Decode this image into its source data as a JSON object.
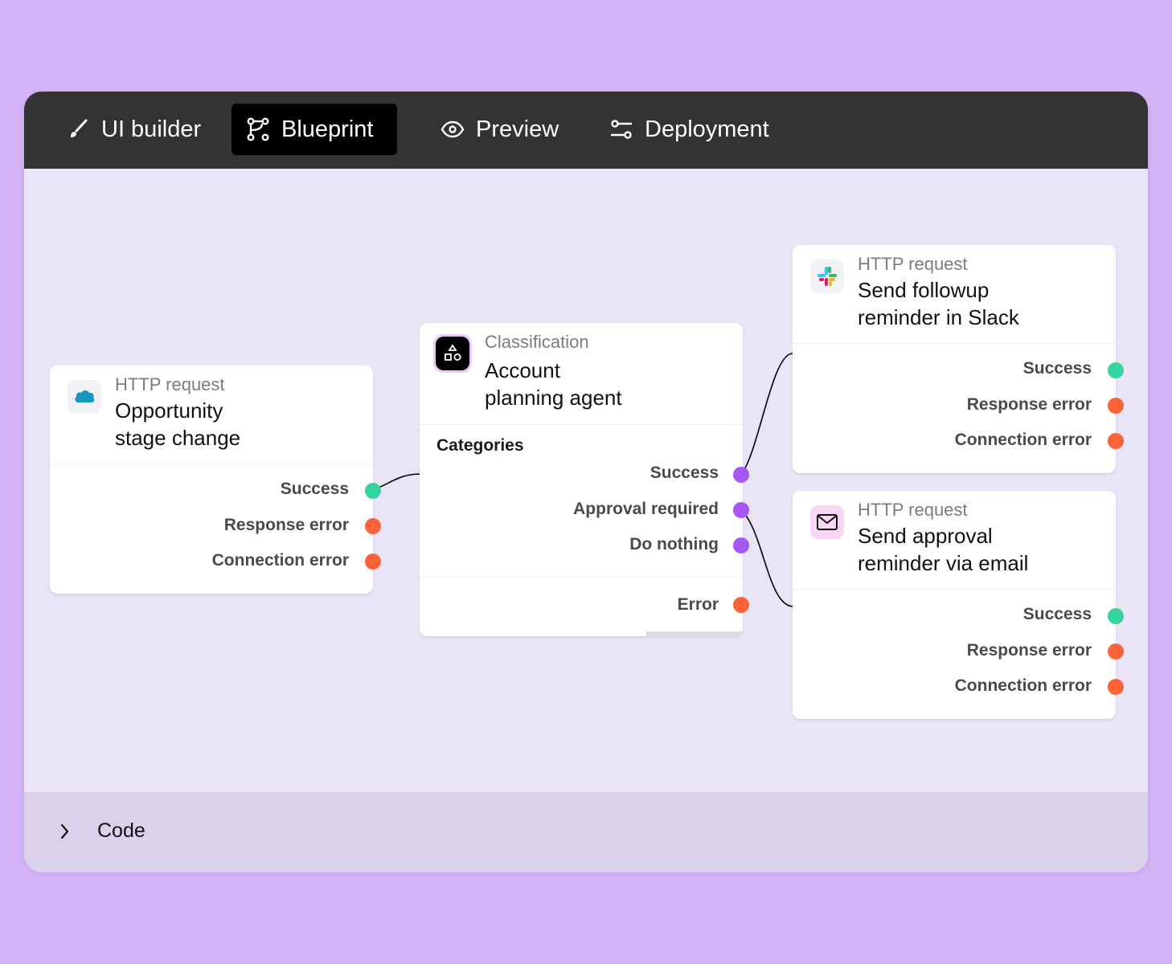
{
  "tabs": [
    {
      "label": "UI builder",
      "icon": "brush-icon",
      "active": false
    },
    {
      "label": "Blueprint",
      "icon": "git-branch-icon",
      "active": true
    },
    {
      "label": "Preview",
      "icon": "eye-icon",
      "active": false
    },
    {
      "label": "Deployment",
      "icon": "sliders-icon",
      "active": false
    }
  ],
  "colors": {
    "success": "#35d39d",
    "error": "#fb6339",
    "category": "#a658f5",
    "background": "#d3b2f6",
    "canvas": "#e9e4f6",
    "topbar": "#333333"
  },
  "nodes": {
    "opportunity": {
      "type": "HTTP request",
      "title_line1": "Opportunity",
      "title_line2": "stage change",
      "icon": "salesforce-icon",
      "ports": [
        "Success",
        "Response error",
        "Connection error"
      ]
    },
    "classification": {
      "type": "Classification",
      "title_line1": "Account",
      "title_line2": "planning agent",
      "icon": "shapes-icon",
      "section": "Categories",
      "ports": [
        "Success",
        "Approval required",
        "Do nothing"
      ],
      "error_port": "Error"
    },
    "slack": {
      "type": "HTTP request",
      "title_line1": "Send followup",
      "title_line2": "reminder in Slack",
      "icon": "slack-icon",
      "ports": [
        "Success",
        "Response error",
        "Connection error"
      ]
    },
    "email": {
      "type": "HTTP request",
      "title_line1": "Send approval",
      "title_line2": "reminder via email",
      "icon": "mail-icon",
      "ports": [
        "Success",
        "Response error",
        "Connection error"
      ]
    }
  },
  "footer": {
    "label": "Code",
    "icon": "chevron-right-icon"
  }
}
